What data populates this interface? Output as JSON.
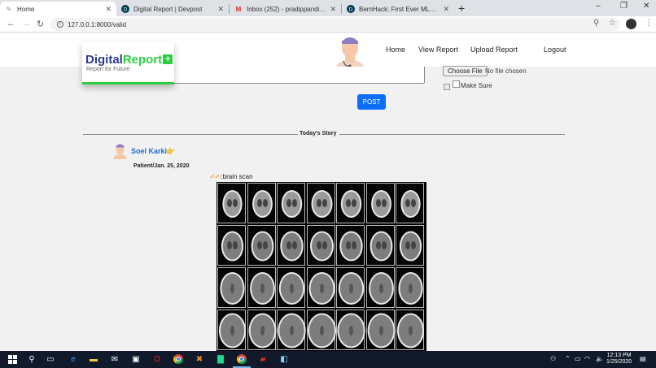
{
  "browser": {
    "tabs": [
      {
        "label": "Home",
        "icon": "feather-icon",
        "active": true
      },
      {
        "label": "Digital Report | Devpost",
        "icon": "devpost-icon",
        "active": false
      },
      {
        "label": "Inbox (252) - pradippandit026@g",
        "icon": "gmail-icon",
        "active": false
      },
      {
        "label": "BernHack: First Ever MLH Memb",
        "icon": "devpost-icon",
        "active": false
      }
    ],
    "new_tab": "+",
    "window_controls": {
      "minimize": "–",
      "maximize": "❐",
      "close": "✕"
    },
    "url": "127.0.0.1:8000/valid"
  },
  "site": {
    "logo_digital": "Digital",
    "logo_report": "Report",
    "logo_plus": "+",
    "tagline": "Report for Future",
    "nav": [
      "Home",
      "View Report",
      "Upload Report",
      "Logout"
    ],
    "file_button": "Choose File",
    "file_status": "No file chosen",
    "make_sure": "Make Sure",
    "post_button": "POST",
    "divider_label": "Today's Story"
  },
  "story": {
    "user_name": "Soel Karki",
    "meta": "Patient/Jan. 25, 2020",
    "caption_emoji": "✍✍",
    "caption_text": ":brain scan"
  },
  "taskbar": {
    "time": "12:13 PM",
    "date": "1/25/2020"
  }
}
